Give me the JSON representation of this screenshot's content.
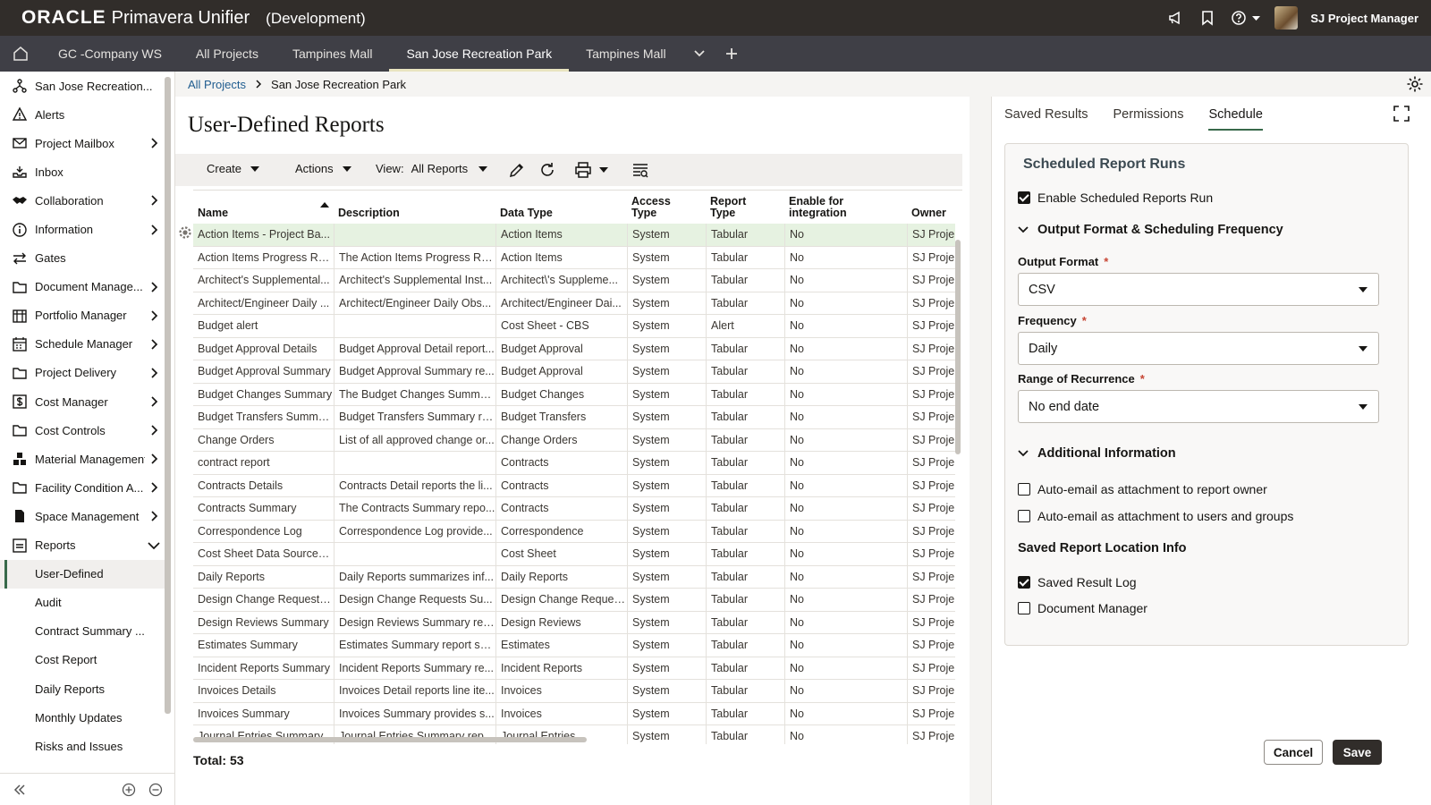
{
  "brand": {
    "oracle": "ORACLE",
    "product": "Primavera Unifier",
    "env": "(Development)"
  },
  "user": {
    "name": "SJ Project Manager"
  },
  "tabs": [
    {
      "label": "GC -Company WS"
    },
    {
      "label": "All Projects"
    },
    {
      "label": "Tampines Mall"
    },
    {
      "label": "San Jose Recreation Park"
    },
    {
      "label": "Tampines Mall"
    }
  ],
  "sidebar": {
    "items": [
      {
        "label": "San Jose Recreation...",
        "icon": "project-tree-icon",
        "chevron": ""
      },
      {
        "label": "Alerts",
        "icon": "alert-icon",
        "chevron": ""
      },
      {
        "label": "Project Mailbox",
        "icon": "mail-icon",
        "chevron": "right"
      },
      {
        "label": "Inbox",
        "icon": "inbox-icon",
        "chevron": ""
      },
      {
        "label": "Collaboration",
        "icon": "handshake-icon",
        "chevron": "right"
      },
      {
        "label": "Information",
        "icon": "info-icon",
        "chevron": "right"
      },
      {
        "label": "Gates",
        "icon": "gates-icon",
        "chevron": ""
      },
      {
        "label": "Document Manage...",
        "icon": "folder-icon",
        "chevron": "right"
      },
      {
        "label": "Portfolio Manager",
        "icon": "portfolio-icon",
        "chevron": "right"
      },
      {
        "label": "Schedule Manager",
        "icon": "calendar-icon",
        "chevron": "right"
      },
      {
        "label": "Project Delivery",
        "icon": "folder-icon",
        "chevron": "right"
      },
      {
        "label": "Cost Manager",
        "icon": "dollar-icon",
        "chevron": "right"
      },
      {
        "label": "Cost Controls",
        "icon": "folder-icon",
        "chevron": "right"
      },
      {
        "label": "Material Management",
        "icon": "boxes-icon",
        "chevron": "right"
      },
      {
        "label": "Facility Condition A...",
        "icon": "folder-icon",
        "chevron": "right"
      },
      {
        "label": "Space Management",
        "icon": "document-icon",
        "chevron": "right"
      },
      {
        "label": "Reports",
        "icon": "reports-icon",
        "chevron": "down"
      }
    ],
    "sub_items": [
      {
        "label": "User-Defined",
        "active": true
      },
      {
        "label": "Audit"
      },
      {
        "label": "Contract Summary ..."
      },
      {
        "label": "Cost Report"
      },
      {
        "label": "Daily Reports"
      },
      {
        "label": "Monthly Updates"
      },
      {
        "label": "Risks and Issues"
      }
    ]
  },
  "breadcrumb": {
    "root": "All Projects",
    "current": "San Jose Recreation Park"
  },
  "main": {
    "title": "User-Defined Reports",
    "toolbar": {
      "create": "Create",
      "actions": "Actions",
      "view_label": "View:",
      "view_value": "All Reports"
    },
    "columns": [
      {
        "label": "Name"
      },
      {
        "label": "Description"
      },
      {
        "label": "Data Type"
      },
      {
        "label": "Access\nType"
      },
      {
        "label": "Report\nType"
      },
      {
        "label": "Enable for\nintegration"
      },
      {
        "label": "Owner"
      }
    ],
    "rows": [
      [
        "Action Items - Project Ba...",
        "",
        "Action Items",
        "System",
        "Tabular",
        "No",
        "SJ Proje"
      ],
      [
        "Action Items Progress Re...",
        "The Action Items Progress Re...",
        "Action Items",
        "System",
        "Tabular",
        "No",
        "SJ Proje"
      ],
      [
        "Architect's Supplemental...",
        "Architect's Supplemental Inst...",
        "Architect\\'s Suppleme...",
        "System",
        "Tabular",
        "No",
        "SJ Proje"
      ],
      [
        "Architect/Engineer Daily ...",
        "Architect/Engineer Daily Obs...",
        "Architect/Engineer Dai...",
        "System",
        "Tabular",
        "No",
        "SJ Proje"
      ],
      [
        "Budget alert",
        "",
        "Cost Sheet - CBS",
        "System",
        "Alert",
        "No",
        "SJ Proje"
      ],
      [
        "Budget Approval Details",
        "Budget Approval Detail report...",
        "Budget Approval",
        "System",
        "Tabular",
        "No",
        "SJ Proje"
      ],
      [
        "Budget Approval Summary",
        "Budget Approval Summary re...",
        "Budget Approval",
        "System",
        "Tabular",
        "No",
        "SJ Proje"
      ],
      [
        "Budget Changes Summary",
        "The Budget Changes Summa...",
        "Budget Changes",
        "System",
        "Tabular",
        "No",
        "SJ Proje"
      ],
      [
        "Budget Transfers Summary",
        "Budget Transfers Summary re...",
        "Budget Transfers",
        "System",
        "Tabular",
        "No",
        "SJ Proje"
      ],
      [
        "Change Orders",
        "List of all approved change or...",
        "Change Orders",
        "System",
        "Tabular",
        "No",
        "SJ Proje"
      ],
      [
        "contract report",
        "",
        "Contracts",
        "System",
        "Tabular",
        "No",
        "SJ Proje"
      ],
      [
        "Contracts Details",
        "Contracts Detail reports the li...",
        "Contracts",
        "System",
        "Tabular",
        "No",
        "SJ Proje"
      ],
      [
        "Contracts Summary",
        "The Contracts Summary repo...",
        "Contracts",
        "System",
        "Tabular",
        "No",
        "SJ Proje"
      ],
      [
        "Correspondence Log",
        "Correspondence Log provide...",
        "Correspondence",
        "System",
        "Tabular",
        "No",
        "SJ Proje"
      ],
      [
        "Cost Sheet Data Sources ...",
        "",
        "Cost Sheet",
        "System",
        "Tabular",
        "No",
        "SJ Proje"
      ],
      [
        "Daily Reports",
        "Daily Reports summarizes inf...",
        "Daily Reports",
        "System",
        "Tabular",
        "No",
        "SJ Proje"
      ],
      [
        "Design Change Requests...",
        "Design Change Requests Su...",
        "Design Change Requests",
        "System",
        "Tabular",
        "No",
        "SJ Proje"
      ],
      [
        "Design Reviews Summary",
        "Design Reviews Summary rep...",
        "Design Reviews",
        "System",
        "Tabular",
        "No",
        "SJ Proje"
      ],
      [
        "Estimates Summary",
        "Estimates Summary report su...",
        "Estimates",
        "System",
        "Tabular",
        "No",
        "SJ Proje"
      ],
      [
        "Incident Reports Summary",
        "Incident Reports Summary re...",
        "Incident Reports",
        "System",
        "Tabular",
        "No",
        "SJ Proje"
      ],
      [
        "Invoices Details",
        "Invoices Detail reports line ite...",
        "Invoices",
        "System",
        "Tabular",
        "No",
        "SJ Proje"
      ],
      [
        "Invoices Summary",
        "Invoices Summary provides s...",
        "Invoices",
        "System",
        "Tabular",
        "No",
        "SJ Proje"
      ],
      [
        "Journal Entries Summary",
        "Journal Entries Summary rep...",
        "Journal Entries",
        "System",
        "Tabular",
        "No",
        "SJ Proje"
      ]
    ],
    "total": "Total: 53"
  },
  "right": {
    "tabs": [
      {
        "label": "Saved Results"
      },
      {
        "label": "Permissions"
      },
      {
        "label": "Schedule"
      }
    ],
    "card_title": "Scheduled Report Runs",
    "enable_label": "Enable Scheduled Reports Run",
    "section1": "Output Format & Scheduling Frequency",
    "output_format_label": "Output Format",
    "output_format_value": "CSV",
    "frequency_label": "Frequency",
    "frequency_value": "Daily",
    "range_label": "Range of Recurrence",
    "range_value": "No end date",
    "required_mark": "*",
    "section2": "Additional Information",
    "auto_email_owner": "Auto-email as attachment to report owner",
    "auto_email_users": "Auto-email as attachment to users and groups",
    "location_head": "Saved Report Location Info",
    "saved_result_log": "Saved Result Log",
    "document_manager": "Document Manager",
    "cancel": "Cancel",
    "save": "Save"
  },
  "colors": {
    "topbar": "#312d2a",
    "tabbar": "#3f3f46",
    "accent": "#38694a",
    "selected_row": "#e6f2e1"
  }
}
